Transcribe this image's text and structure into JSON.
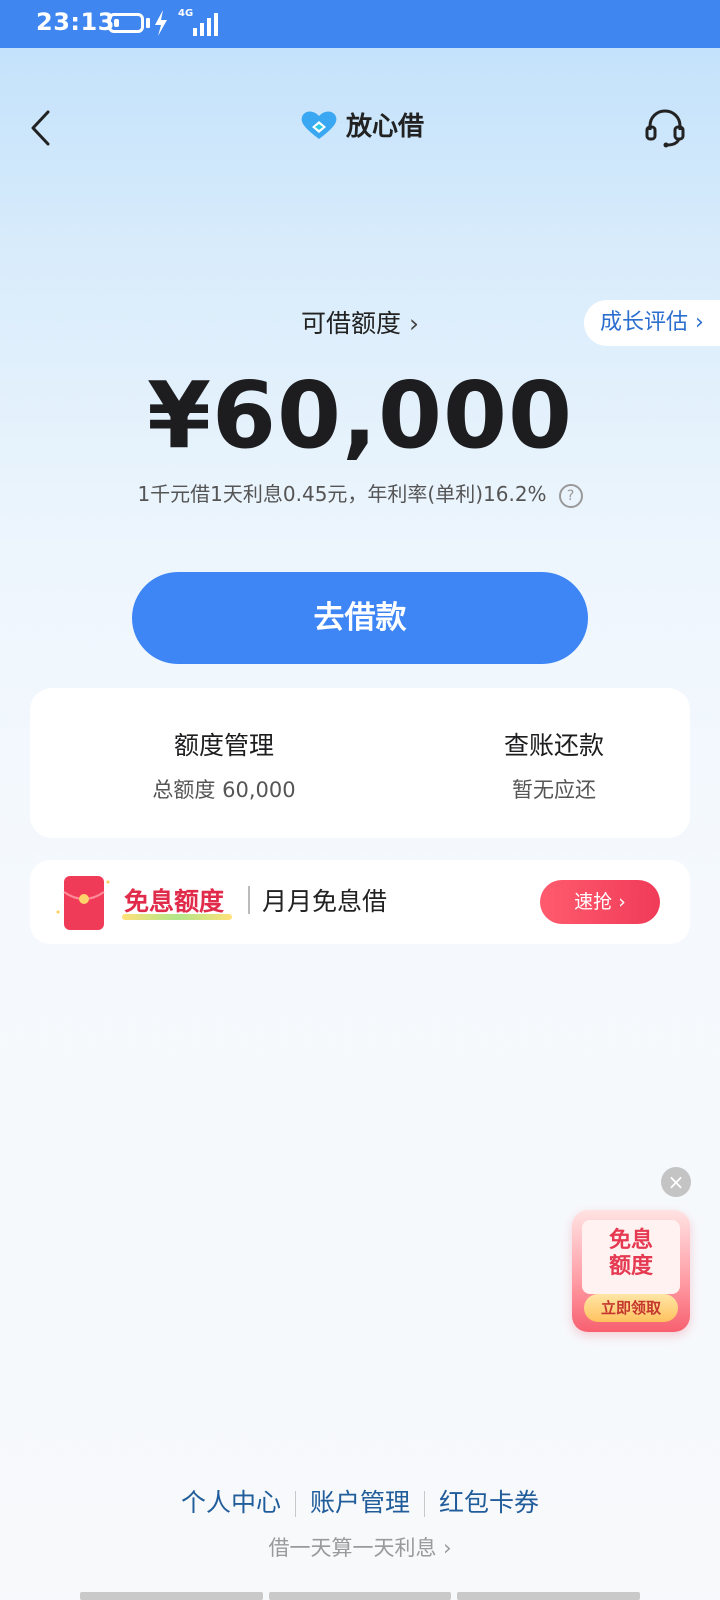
{
  "status": {
    "time": "23:13",
    "network": "4G",
    "battery_level": 0.22
  },
  "header": {
    "app_name": "放心借"
  },
  "credit": {
    "title": "可借额度",
    "amount": "¥60,000",
    "rate_text": "1千元借1天利息0.45元，年利率(单利)16.2%",
    "growth_label": "成长评估"
  },
  "borrow_button": "去借款",
  "manage": {
    "left_title": "额度管理",
    "left_sub": "总额度 60,000",
    "right_title": "查账还款",
    "right_sub": "暂无应还"
  },
  "promo": {
    "title": "免息额度",
    "subtitle": "月月免息借",
    "button": "速抢"
  },
  "floating": {
    "line1": "免息",
    "line2": "额度",
    "button": "立即领取"
  },
  "footer": {
    "links": [
      "个人中心",
      "账户管理",
      "红包卡券"
    ],
    "note": "借一天算一天利息"
  },
  "colors": {
    "accent": "#3e86f5",
    "promo_red": "#e02c4a",
    "link": "#215d9a"
  },
  "icons": [
    "back-icon",
    "brand-logo-icon",
    "headset-icon",
    "help-icon",
    "envelope-icon",
    "close-icon",
    "bolt-icon",
    "signal-icon",
    "battery-icon"
  ]
}
